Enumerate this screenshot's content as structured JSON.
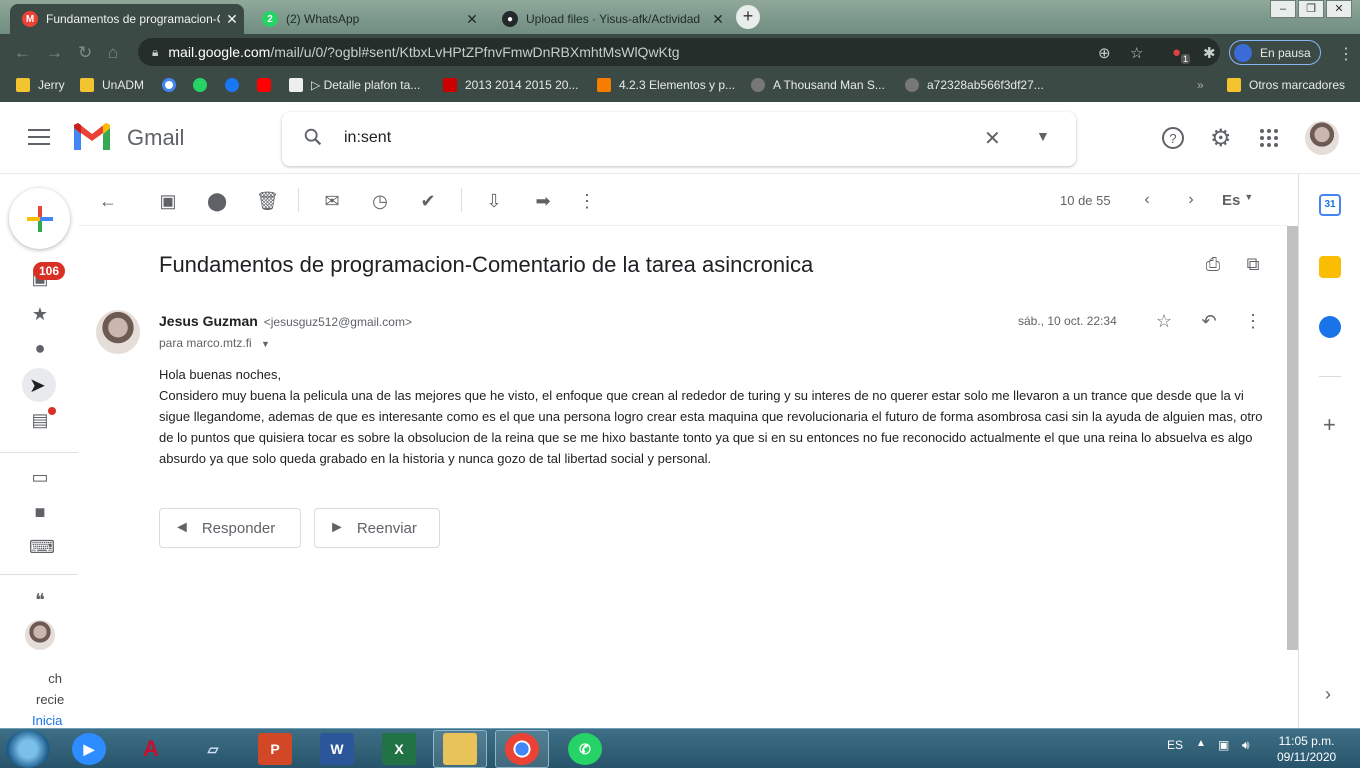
{
  "browser": {
    "tabs": [
      {
        "label": "Fundamentos de programacion-C",
        "active": true
      },
      {
        "label": "(2) WhatsApp",
        "active": false
      },
      {
        "label": "Upload files · Yisus-afk/Actividad",
        "active": false
      }
    ],
    "window_buttons": [
      "–",
      "❐",
      "✕"
    ],
    "url_host": "mail.google.com",
    "url_path": "/mail/u/0/?ogbl#sent/KtbxLvHPtZPfnvFmwDnRBXmhtMsWlQwKtg",
    "extension_badge": "1",
    "profile_status": "En pausa",
    "bookmarks": [
      "Jerry",
      "UnADM",
      "▷ Detalle plafon ta...",
      "2013 2014 2015 20...",
      "4.2.3 Elementos y p...",
      "A Thousand Man S...",
      "a72328ab566f3df27...",
      "Otros marcadores"
    ],
    "bookmarks_overflow": "»"
  },
  "gmail": {
    "product_name": "Gmail",
    "search_query": "in:sent",
    "rail_badge": "106",
    "hangouts_lines": [
      "ch",
      "recie",
      "Inicia"
    ],
    "pager": "10 de 55",
    "input_lang": "Es",
    "subject": "Fundamentos de programacion-Comentario de la tarea asincronica",
    "sender_name": "Jesus Guzman",
    "sender_email": "<jesusguz512@gmail.com>",
    "recipient": "para marco.mtz.fi",
    "date": "sáb., 10 oct. 22:34",
    "body_lines": [
      "Hola buenas noches,",
      "Considero muy buena la pelicula una de las mejores que he visto, el enfoque que crean al rededor de turing y su interes de no querer estar solo me llevaron a un trance que desde que la vi sigue llegandome, ademas de que es interesante como es el que una persona logro crear esta maquina que revolucionaria el futuro de forma asombrosa casi sin la ayuda de alguien mas, otro de lo puntos que quisiera tocar es sobre la obsolucion de la reina que se me hixo bastante tonto ya que si en su entonces no fue reconocido actualmente el que una reina lo absuelva es algo absurdo ya que solo queda grabado en la historia y nunca gozo de tal libertad social y personal."
    ],
    "reply_label": "Responder",
    "forward_label": "Reenviar",
    "calendar_day": "31"
  },
  "taskbar": {
    "lang": "ES",
    "time": "11:05 p.m.",
    "date": "09/11/2020"
  },
  "colors": {
    "gmail_red": "#ea4335",
    "badge_red": "#d93025",
    "chrome_dark": "#3c4a45",
    "taskbar": "#2f6078"
  }
}
